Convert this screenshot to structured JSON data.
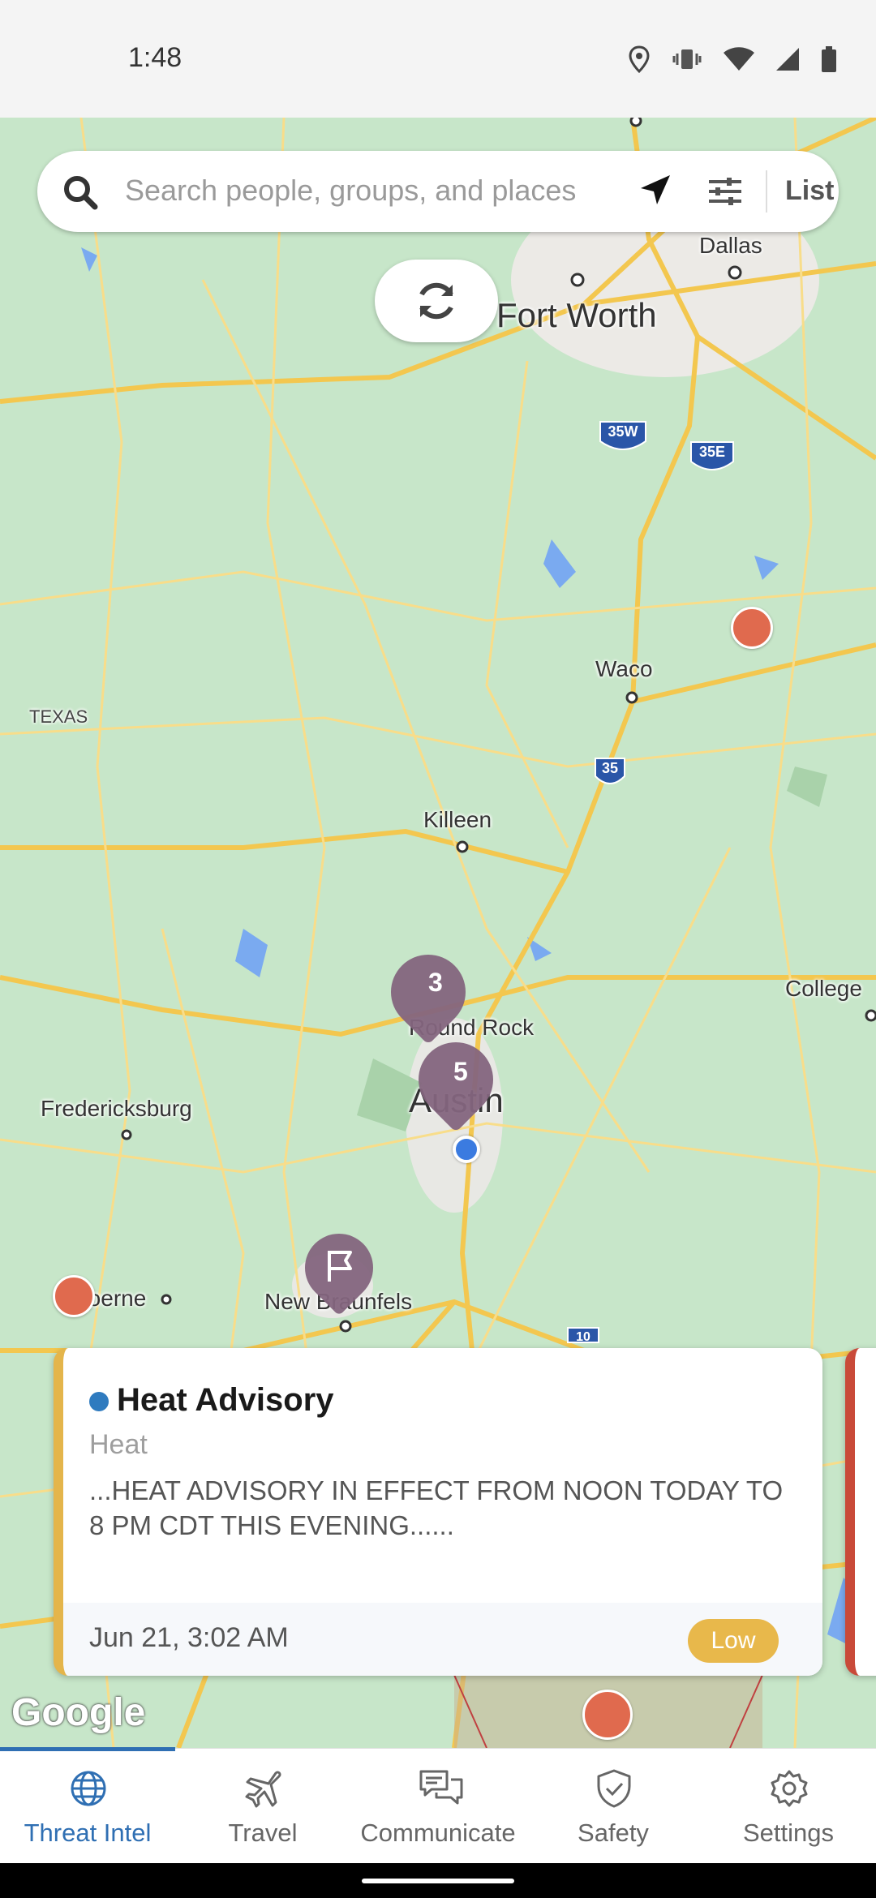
{
  "status_bar": {
    "time": "1:48",
    "icons": [
      "location-icon",
      "vibrate-icon",
      "wifi-icon",
      "signal-icon",
      "battery-icon"
    ]
  },
  "search": {
    "placeholder": "Search people, groups, and places",
    "list_label": "List"
  },
  "map": {
    "labels": {
      "dallas": "Dallas",
      "fort_worth": "Fort Worth",
      "waco": "Waco",
      "texas": "TEXAS",
      "killeen": "Killeen",
      "college": "College",
      "round_rock": "Round Rock",
      "austin": "Austin",
      "fredericksburg": "Fredericksburg",
      "boerne": "Boerne",
      "new_braunfels": "New Braunfels"
    },
    "highway_shields": [
      "35W",
      "35E",
      "35",
      "10"
    ],
    "clusters": [
      {
        "count": "3"
      },
      {
        "count": "5"
      }
    ],
    "attribution": "Google"
  },
  "alert_card": {
    "title": "Heat Advisory",
    "category": "Heat",
    "body": "...HEAT ADVISORY IN EFFECT FROM NOON TODAY TO 8 PM CDT THIS EVENING......",
    "date": "Jun 21, 3:02 AM",
    "severity": "Low",
    "accent_color": "#e4b54b",
    "dot_color": "#2f7bbf"
  },
  "nav": {
    "items": [
      {
        "label": "Threat Intel",
        "icon": "globe-icon",
        "active": true
      },
      {
        "label": "Travel",
        "icon": "airplane-icon",
        "active": false
      },
      {
        "label": "Communicate",
        "icon": "chat-icon",
        "active": false
      },
      {
        "label": "Safety",
        "icon": "shield-check-icon",
        "active": false
      },
      {
        "label": "Settings",
        "icon": "gear-icon",
        "active": false
      }
    ],
    "active_color": "#2f6fb3"
  }
}
